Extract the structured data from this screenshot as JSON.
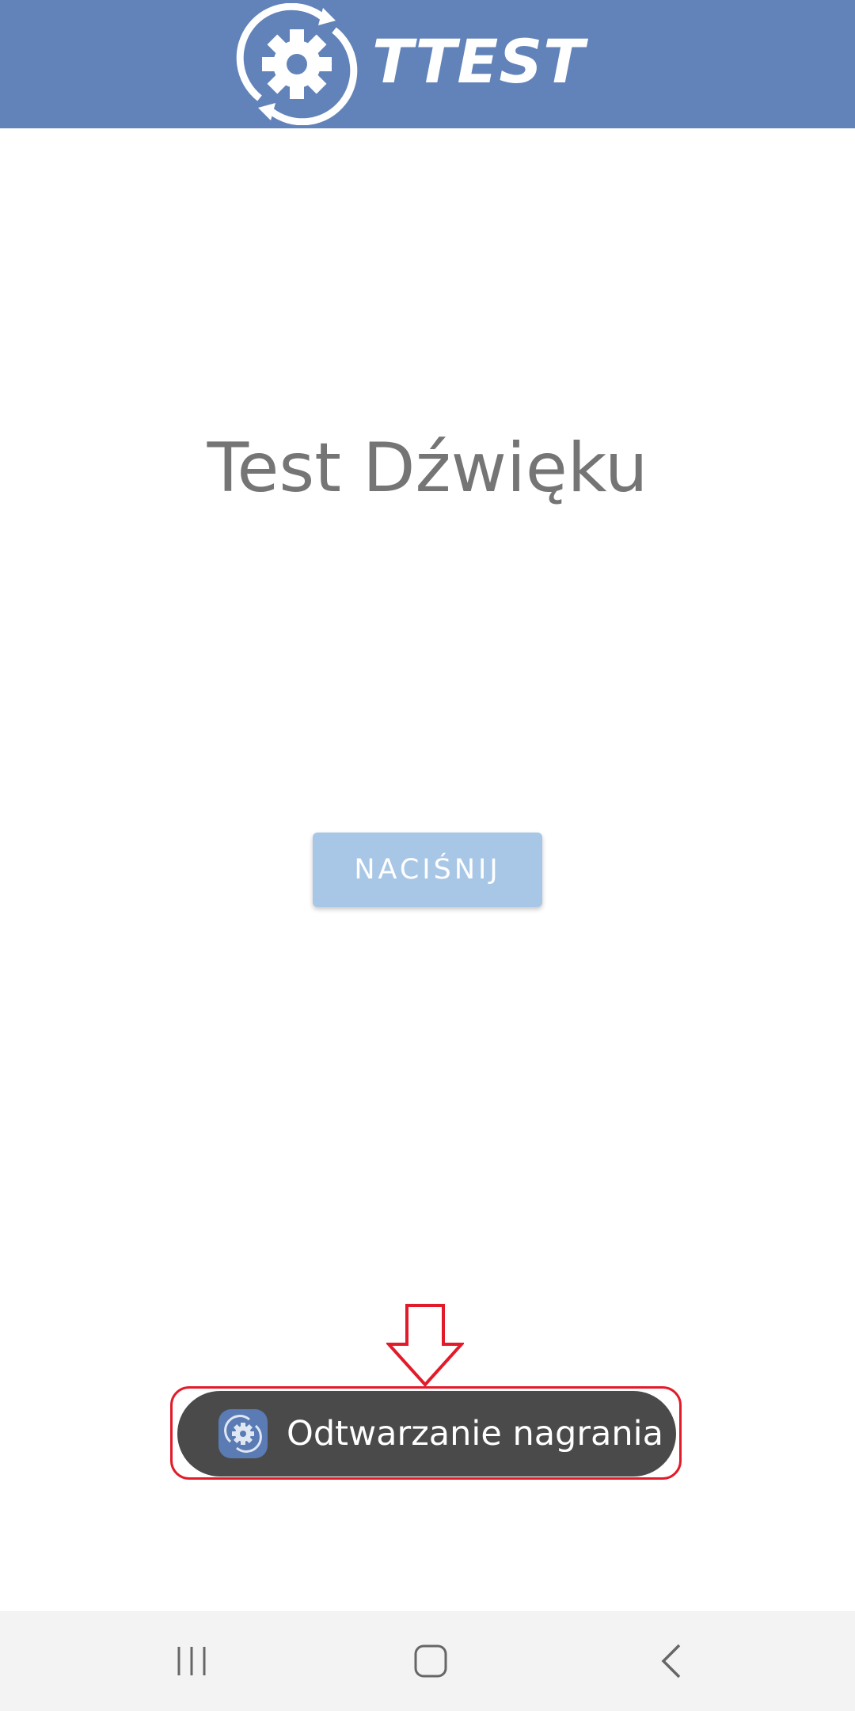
{
  "header": {
    "logo_text": "TTEST"
  },
  "main": {
    "title": "Test Dźwięku",
    "button_label": "NACIŚNIJ"
  },
  "toast": {
    "message": "Odtwarzanie nagrania",
    "icon": "app-gear-icon"
  },
  "annotation": {
    "highlight_color": "#e21b2a",
    "arrow_icon": "down-arrow-icon"
  },
  "navbar": {
    "recents_icon": "recents-icon",
    "home_icon": "home-icon",
    "back_icon": "back-icon"
  },
  "colors": {
    "header_bg": "#6283b9",
    "button_bg": "#a8c7e6",
    "toast_bg": "#4a4a4a",
    "title_color": "#757575"
  }
}
